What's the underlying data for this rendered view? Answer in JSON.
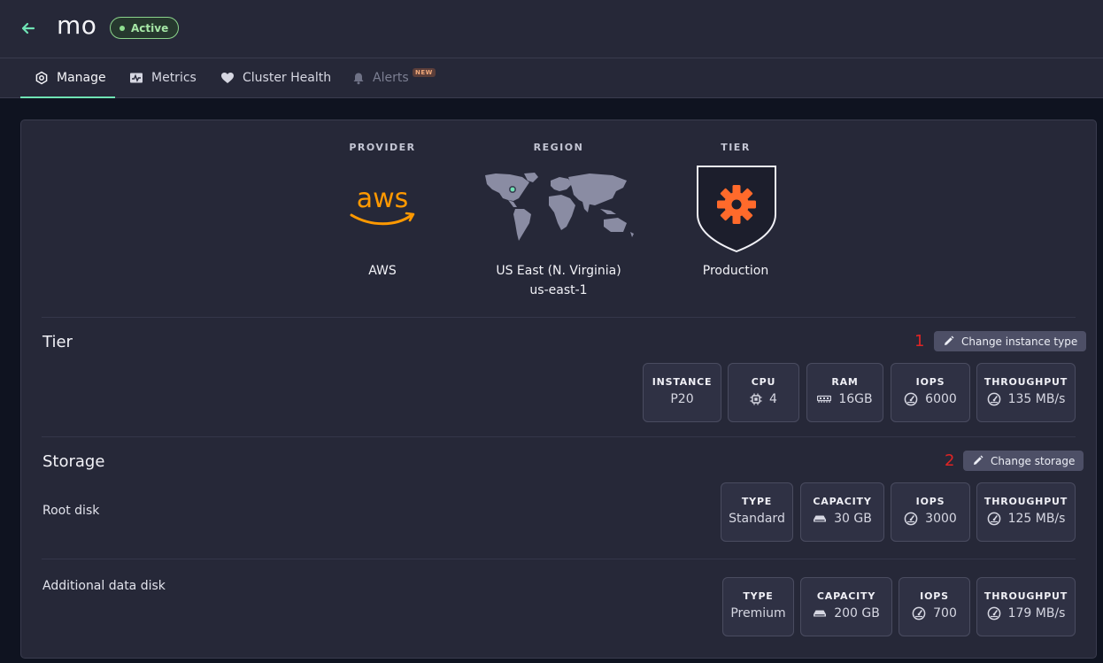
{
  "header": {
    "cluster_name": "mo",
    "status": "Active"
  },
  "tabs": [
    {
      "label": "Manage",
      "icon": "gear-hexagon-icon",
      "active": true
    },
    {
      "label": "Metrics",
      "icon": "chart-icon"
    },
    {
      "label": "Cluster Health",
      "icon": "heart-icon"
    },
    {
      "label": "Alerts",
      "icon": "bell-icon",
      "disabled": true,
      "badge": "NEW"
    }
  ],
  "summary": {
    "provider": {
      "label": "PROVIDER",
      "value": "AWS",
      "icon": "aws-logo"
    },
    "region": {
      "label": "REGION",
      "value": "US East (N. Virginia)",
      "sub": "us-east-1",
      "icon": "world-map"
    },
    "tier": {
      "label": "TIER",
      "value": "Production",
      "icon": "shield-gear-icon"
    }
  },
  "tier_section": {
    "title": "Tier",
    "annotation": "1",
    "action_label": "Change instance type",
    "stats": [
      {
        "label": "INSTANCE",
        "value": "P20"
      },
      {
        "label": "CPU",
        "value": "4",
        "icon": "cpu-icon"
      },
      {
        "label": "RAM",
        "value": "16GB",
        "icon": "ram-icon"
      },
      {
        "label": "IOPS",
        "value": "6000",
        "icon": "gauge-icon"
      },
      {
        "label": "THROUGHPUT",
        "value": "135 MB/s",
        "icon": "gauge-icon"
      }
    ]
  },
  "storage_section": {
    "title": "Storage",
    "annotation": "2",
    "action_label": "Change storage",
    "root_disk": {
      "label": "Root disk",
      "stats": [
        {
          "label": "TYPE",
          "value": "Standard"
        },
        {
          "label": "CAPACITY",
          "value": "30 GB",
          "icon": "disk-icon"
        },
        {
          "label": "IOPS",
          "value": "3000",
          "icon": "gauge-icon"
        },
        {
          "label": "THROUGHPUT",
          "value": "125 MB/s",
          "icon": "gauge-icon"
        }
      ]
    },
    "data_disk": {
      "label": "Additional data disk",
      "stats": [
        {
          "label": "TYPE",
          "value": "Premium"
        },
        {
          "label": "CAPACITY",
          "value": "200 GB",
          "icon": "disk-icon"
        },
        {
          "label": "IOPS",
          "value": "700",
          "icon": "gauge-icon"
        },
        {
          "label": "THROUGHPUT",
          "value": "179 MB/s",
          "icon": "gauge-icon"
        }
      ]
    }
  },
  "colors": {
    "accent": "#6fe3b4",
    "active_badge": "#8bd48b",
    "aws_orange": "#ff9900",
    "tier_orange": "#ff6a2b",
    "annotation_red": "#e02424"
  }
}
